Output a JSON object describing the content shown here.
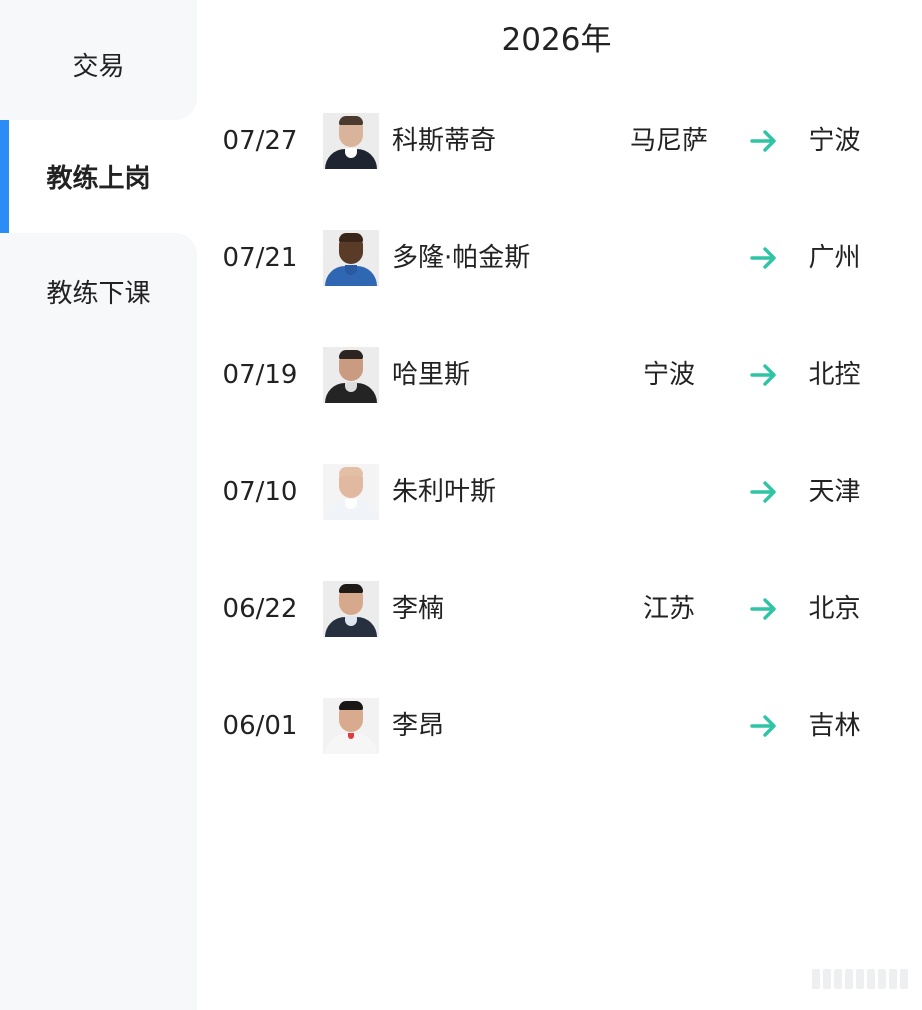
{
  "sidebar": {
    "items": [
      {
        "label": "交易"
      },
      {
        "label": "教练上岗"
      },
      {
        "label": "教练下课"
      }
    ],
    "active_index": 1,
    "accent_color": "#2b8cf5"
  },
  "main": {
    "year": "2026年",
    "arrow_color": "#2ec4a4",
    "rows": [
      {
        "date": "07/27",
        "name": "科斯蒂奇",
        "from": "马尼萨",
        "to": "宁波"
      },
      {
        "date": "07/21",
        "name": "多隆·帕金斯",
        "from": "",
        "to": "广州"
      },
      {
        "date": "07/19",
        "name": "哈里斯",
        "from": "宁波",
        "to": "北控"
      },
      {
        "date": "07/10",
        "name": "朱利叶斯",
        "from": "",
        "to": "天津"
      },
      {
        "date": "06/22",
        "name": "李楠",
        "from": "江苏",
        "to": "北京"
      },
      {
        "date": "06/01",
        "name": "李昂",
        "from": "",
        "to": "吉林"
      }
    ]
  },
  "icons": {
    "arrow": "arrow-right-icon",
    "avatar": "coach-avatar"
  }
}
